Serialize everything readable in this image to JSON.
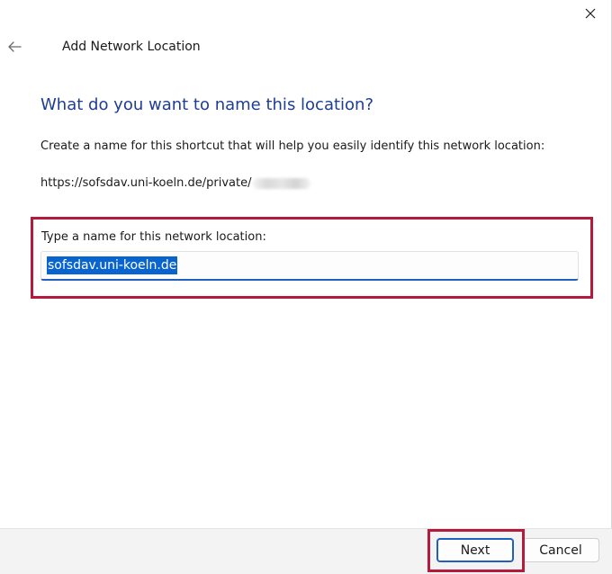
{
  "window": {
    "title": "Add Network Location"
  },
  "page": {
    "heading": "What do you want to name this location?",
    "instruction": "Create a name for this shortcut that will help you easily identify this network location:",
    "url_prefix": "https://sofsdav.uni-koeln.de/private/"
  },
  "name_field": {
    "label": "Type a name for this network location:",
    "value": "sofsdav.uni-koeln.de"
  },
  "footer": {
    "next_label": "Next",
    "cancel_label": "Cancel"
  },
  "icons": {
    "close": "close-icon",
    "back": "back-arrow-icon"
  },
  "colors": {
    "heading": "#1f3d95",
    "highlight_border": "#b5193b",
    "selection": "#0a64d0",
    "focus_accent": "#1f5fbf"
  }
}
